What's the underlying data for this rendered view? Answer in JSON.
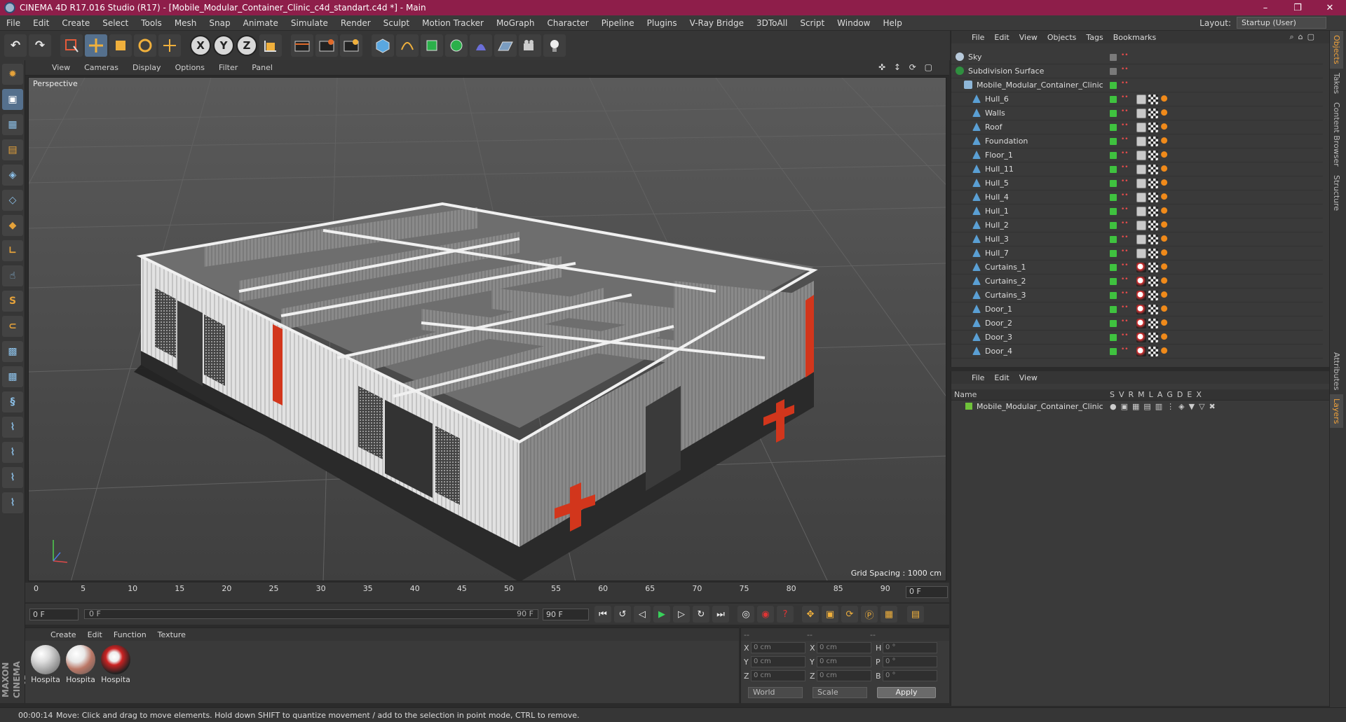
{
  "window": {
    "title": "CINEMA 4D R17.016 Studio (R17) - [Mobile_Modular_Container_Clinic_c4d_standart.c4d *] - Main",
    "minimize": "–",
    "maximize": "❐",
    "close": "✕"
  },
  "menu": [
    "File",
    "Edit",
    "Create",
    "Select",
    "Tools",
    "Mesh",
    "Snap",
    "Animate",
    "Simulate",
    "Render",
    "Sculpt",
    "Motion Tracker",
    "MoGraph",
    "Character",
    "Pipeline",
    "Plugins",
    "V-Ray Bridge",
    "3DToAll",
    "Script",
    "Window",
    "Help"
  ],
  "layout": {
    "label": "Layout:",
    "value": "Startup (User)"
  },
  "toolbar": {
    "undo": "↶",
    "redo": "↷",
    "axes": [
      "X",
      "Y",
      "Z"
    ]
  },
  "viewport": {
    "menu": [
      "View",
      "Cameras",
      "Display",
      "Options",
      "Filter",
      "Panel"
    ],
    "label": "Perspective",
    "grid_spacing": "Grid Spacing : 1000 cm",
    "nav_icons": "✜ ↕ ⟳ ▢"
  },
  "timeline": {
    "ticks": [
      "0",
      "5",
      "10",
      "15",
      "20",
      "25",
      "30",
      "35",
      "40",
      "45",
      "50",
      "55",
      "60",
      "65",
      "70",
      "75",
      "80",
      "85",
      "90"
    ],
    "current_frame": "0 F"
  },
  "playback": {
    "start": "0 F",
    "range_start": "0 F",
    "range_end": "90 F",
    "end": "90 F"
  },
  "materials": {
    "menu": [
      "Create",
      "Edit",
      "Function",
      "Texture"
    ],
    "items": [
      {
        "label": "Hospita"
      },
      {
        "label": "Hospita"
      },
      {
        "label": "Hospita"
      }
    ]
  },
  "coords": {
    "head": [
      "--",
      "--",
      "--"
    ],
    "rows": [
      {
        "a": "X",
        "v1": "0 cm",
        "b": "X",
        "v2": "0 cm",
        "c": "H",
        "v3": "0 °"
      },
      {
        "a": "Y",
        "v1": "0 cm",
        "b": "Y",
        "v2": "0 cm",
        "c": "P",
        "v3": "0 °"
      },
      {
        "a": "Z",
        "v1": "0 cm",
        "b": "Z",
        "v2": "0 cm",
        "c": "B",
        "v3": "0 °"
      }
    ],
    "world": "World",
    "scale": "Scale",
    "apply": "Apply"
  },
  "status": {
    "time": "00:00:14",
    "message": "Move: Click and drag to move elements. Hold down SHIFT to quantize movement / add to the selection in point mode, CTRL to remove."
  },
  "brand": "MAXON CINEMA 4D",
  "object_manager": {
    "menu": [
      "File",
      "Edit",
      "View",
      "Objects",
      "Tags",
      "Bookmarks"
    ],
    "objects": [
      {
        "name": "Sky",
        "icon": "sky",
        "indent": 0
      },
      {
        "name": "Subdivision Surface",
        "icon": "sub",
        "indent": 0
      },
      {
        "name": "Mobile_Modular_Container_Clinic",
        "icon": "null",
        "indent": 1
      },
      {
        "name": "Hull_6",
        "icon": "poly",
        "indent": 2
      },
      {
        "name": "Walls",
        "icon": "poly",
        "indent": 2
      },
      {
        "name": "Roof",
        "icon": "poly",
        "indent": 2
      },
      {
        "name": "Foundation",
        "icon": "poly",
        "indent": 2
      },
      {
        "name": "Floor_1",
        "icon": "poly",
        "indent": 2
      },
      {
        "name": "Hull_11",
        "icon": "poly",
        "indent": 2
      },
      {
        "name": "Hull_5",
        "icon": "poly",
        "indent": 2
      },
      {
        "name": "Hull_4",
        "icon": "poly",
        "indent": 2
      },
      {
        "name": "Hull_1",
        "icon": "poly",
        "indent": 2
      },
      {
        "name": "Hull_2",
        "icon": "poly",
        "indent": 2
      },
      {
        "name": "Hull_3",
        "icon": "poly",
        "indent": 2
      },
      {
        "name": "Hull_7",
        "icon": "poly",
        "indent": 2
      },
      {
        "name": "Curtains_1",
        "icon": "poly",
        "indent": 2
      },
      {
        "name": "Curtains_2",
        "icon": "poly",
        "indent": 2
      },
      {
        "name": "Curtains_3",
        "icon": "poly",
        "indent": 2
      },
      {
        "name": "Door_1",
        "icon": "poly",
        "indent": 2
      },
      {
        "name": "Door_2",
        "icon": "poly",
        "indent": 2
      },
      {
        "name": "Door_3",
        "icon": "poly",
        "indent": 2
      },
      {
        "name": "Door_4",
        "icon": "poly",
        "indent": 2
      }
    ]
  },
  "layer_manager": {
    "menu": [
      "File",
      "Edit",
      "View"
    ],
    "header_name": "Name",
    "columns": [
      "S",
      "V",
      "R",
      "M",
      "L",
      "A",
      "G",
      "D",
      "E",
      "X"
    ],
    "layers": [
      {
        "name": "Mobile_Modular_Container_Clinic"
      }
    ]
  },
  "side_tabs": [
    "Objects",
    "Takes",
    "Content Browser",
    "Structure",
    "Attributes",
    "Layers"
  ]
}
